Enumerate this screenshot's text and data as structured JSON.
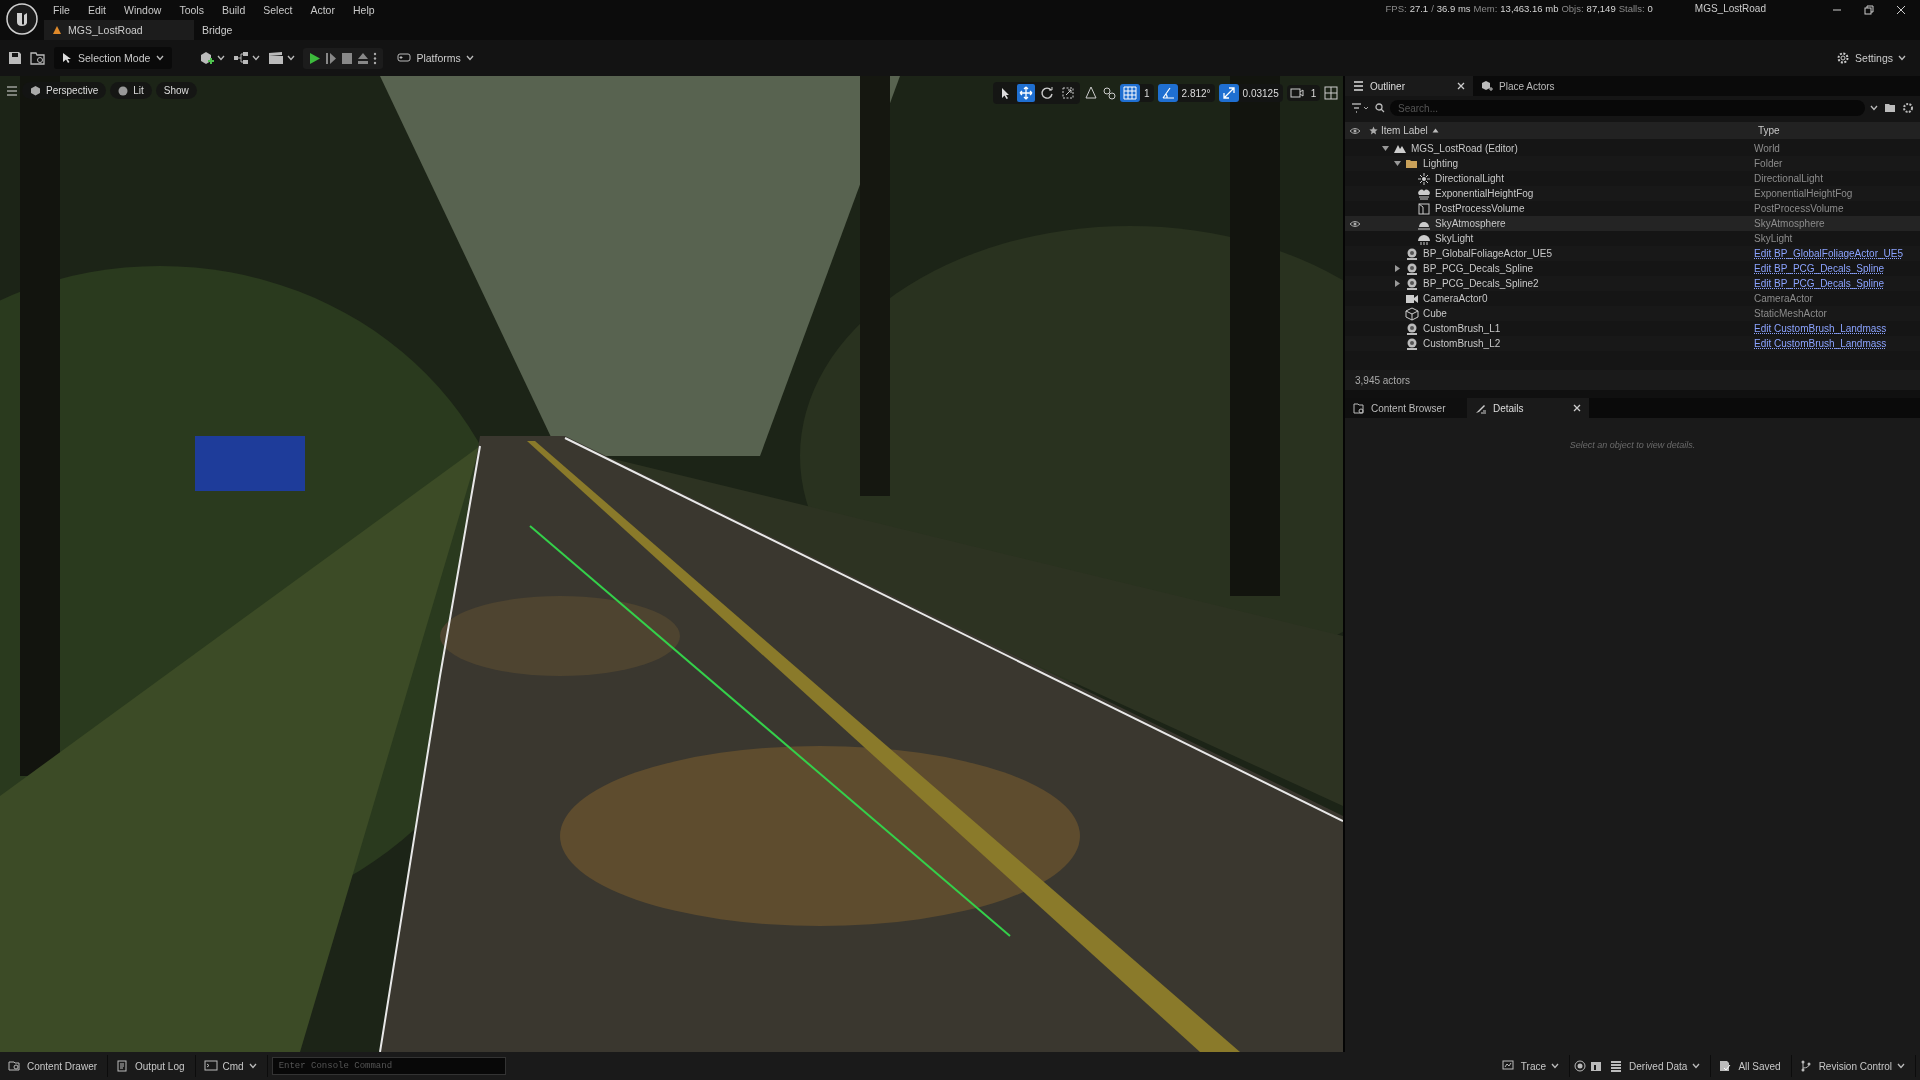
{
  "window": {
    "title": "MGS_LostRoad"
  },
  "menu": [
    "File",
    "Edit",
    "Window",
    "Tools",
    "Build",
    "Select",
    "Actor",
    "Help"
  ],
  "document_tabs": [
    {
      "label": "MGS_LostRoad",
      "selected": true
    },
    {
      "label": "Bridge",
      "selected": false
    }
  ],
  "stats": [
    {
      "label": "FPS:",
      "value": "27.1"
    },
    {
      "label": "/",
      "value": "36.9 ms"
    },
    {
      "label": "Mem:",
      "value": "13,463.16 mb"
    },
    {
      "label": "Objs:",
      "value": "87,149"
    },
    {
      "label": "Stalls:",
      "value": "0"
    }
  ],
  "toolbar": {
    "selection_mode": "Selection Mode",
    "platforms": "Platforms",
    "settings": "Settings"
  },
  "viewport": {
    "view_buttons": [
      {
        "kind": "perspective",
        "label": "Perspective"
      },
      {
        "kind": "lit",
        "label": "Lit"
      },
      {
        "kind": "show",
        "label": "Show"
      }
    ],
    "transform_tools": [
      {
        "kind": "select",
        "selected": false
      },
      {
        "kind": "move",
        "selected": true
      },
      {
        "kind": "rotate",
        "selected": false
      },
      {
        "kind": "scale",
        "selected": false
      }
    ],
    "snaps": [
      {
        "kind": "grid",
        "value": "1",
        "on": true
      },
      {
        "kind": "rotation",
        "value": "2.812°",
        "on": true
      },
      {
        "kind": "scale",
        "value": "0.03125",
        "on": true
      }
    ],
    "camera_speed": "1"
  },
  "outliner": {
    "tabs": [
      {
        "label": "Outliner",
        "selected": true
      },
      {
        "label": "Place Actors",
        "selected": false
      }
    ],
    "search": {
      "placeholder": "Search..."
    },
    "columns": [
      "Item Label",
      "Type"
    ],
    "tree": [
      {
        "kind": "world",
        "label": "MGS_LostRoad (Editor)",
        "type": "World",
        "link": false,
        "hovered": false,
        "expanded": true,
        "children": [
          {
            "kind": "folder",
            "label": "Lighting",
            "type": "Folder",
            "link": false,
            "hovered": false,
            "expanded": true,
            "children": [
              {
                "kind": "light",
                "label": "DirectionalLight",
                "type": "DirectionalLight",
                "link": false,
                "hovered": false
              },
              {
                "kind": "fog",
                "label": "ExponentialHeightFog",
                "type": "ExponentialHeightFog",
                "link": false,
                "hovered": false
              },
              {
                "kind": "volume",
                "label": "PostProcessVolume",
                "type": "PostProcessVolume",
                "link": false,
                "hovered": false
              },
              {
                "kind": "sky",
                "label": "SkyAtmosphere",
                "type": "SkyAtmosphere",
                "link": false,
                "hovered": true
              },
              {
                "kind": "skylight",
                "label": "SkyLight",
                "type": "SkyLight",
                "link": false,
                "hovered": false
              }
            ]
          },
          {
            "kind": "blueprint",
            "label": "BP_GlobalFoliageActor_UE5",
            "type": "Edit BP_GlobalFoliageActor_UE5",
            "link": true,
            "hovered": false
          },
          {
            "kind": "blueprint",
            "label": "BP_PCG_Decals_Spline",
            "type": "Edit BP_PCG_Decals_Spline",
            "link": true,
            "hovered": false,
            "expanded": false
          },
          {
            "kind": "blueprint",
            "label": "BP_PCG_Decals_Spline2",
            "type": "Edit BP_PCG_Decals_Spline",
            "link": true,
            "hovered": false,
            "expanded": false
          },
          {
            "kind": "camera",
            "label": "CameraActor0",
            "type": "CameraActor",
            "link": false,
            "hovered": false
          },
          {
            "kind": "cube",
            "label": "Cube",
            "type": "StaticMeshActor",
            "link": false,
            "hovered": false
          },
          {
            "kind": "blueprint",
            "label": "CustomBrush_L1",
            "type": "Edit CustomBrush_Landmass",
            "link": true,
            "hovered": false
          },
          {
            "kind": "blueprint",
            "label": "CustomBrush_L2",
            "type": "Edit CustomBrush_Landmass",
            "link": true,
            "hovered": false
          }
        ]
      }
    ],
    "footer": "3,945 actors"
  },
  "details": {
    "tabs": [
      {
        "label": "Content Browser",
        "selected": false
      },
      {
        "label": "Details",
        "selected": true
      }
    ],
    "message": "Select an object to view details."
  },
  "status_bar": {
    "left": [
      {
        "kind": "drawer",
        "label": "Content Drawer"
      },
      {
        "kind": "log",
        "label": "Output Log"
      },
      {
        "kind": "cmd",
        "label": "Cmd"
      }
    ],
    "console": {
      "placeholder": "Enter Console Command"
    },
    "right": [
      {
        "kind": "trace",
        "label": "Trace"
      },
      {
        "kind": "derived",
        "label": "Derived Data"
      },
      {
        "kind": "saved",
        "label": "All Saved"
      },
      {
        "kind": "revision",
        "label": "Revision Control"
      }
    ]
  }
}
